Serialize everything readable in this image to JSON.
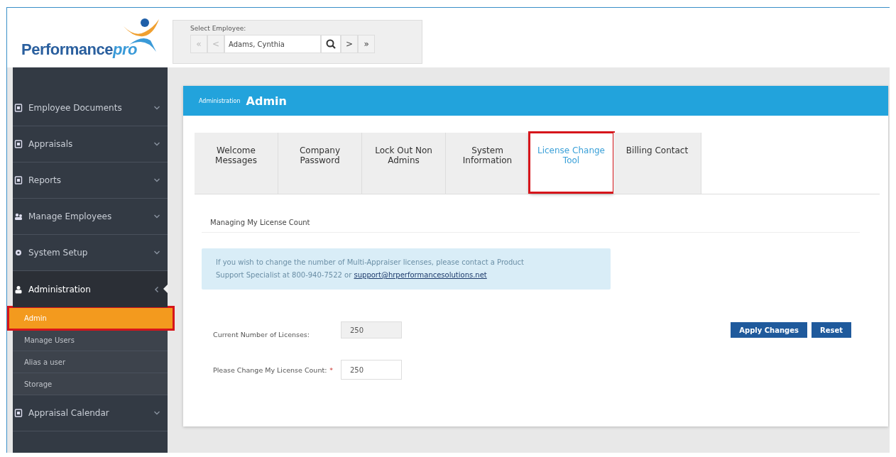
{
  "logo": {
    "name": "Performance",
    "suffix": "pro"
  },
  "employee_selector": {
    "label": "Select Employee:",
    "value": "Adams, Cynthia",
    "first": "«",
    "prev": "<",
    "next": ">",
    "last": "»"
  },
  "sidebar": {
    "items": [
      {
        "label": "Employee Documents",
        "expanded": false
      },
      {
        "label": "Appraisals",
        "expanded": false
      },
      {
        "label": "Reports",
        "expanded": false
      },
      {
        "label": "Manage Employees",
        "expanded": false
      },
      {
        "label": "System Setup",
        "expanded": false
      },
      {
        "label": "Administration",
        "expanded": true,
        "children": [
          {
            "label": "Admin",
            "selected": true,
            "highlighted": true
          },
          {
            "label": "Manage Users",
            "selected": false,
            "highlighted": false
          },
          {
            "label": "Alias a user",
            "selected": false,
            "highlighted": false
          },
          {
            "label": "Storage",
            "selected": false,
            "highlighted": false
          }
        ]
      },
      {
        "label": "Appraisal Calendar",
        "expanded": false
      }
    ]
  },
  "panel": {
    "breadcrumb": "Administration",
    "title": "Admin",
    "tabs": [
      {
        "label": "Welcome Messages",
        "selected": false,
        "highlighted": false
      },
      {
        "label": "Company Password",
        "selected": false,
        "highlighted": false
      },
      {
        "label": "Lock Out Non Admins",
        "selected": false,
        "highlighted": false
      },
      {
        "label": "System Information",
        "selected": false,
        "highlighted": false
      },
      {
        "label": "License Change Tool",
        "selected": true,
        "highlighted": true
      },
      {
        "label": "Billing Contact",
        "selected": false,
        "highlighted": false
      }
    ],
    "section_title": "Managing My License Count",
    "info": {
      "text": "If you wish to change the number of Multi-Appraiser licenses, please contact a Product Support Specialist at 800-940-7522 or",
      "link": "support@hrperformancesolutions.net"
    },
    "fields": [
      {
        "label": "Current Number of Licenses:",
        "value": "250",
        "disabled": true
      },
      {
        "label": "Please Change My License Count:",
        "value": "250",
        "required_mark": "*",
        "disabled": false
      }
    ],
    "buttons": [
      "Apply Changes",
      "Reset"
    ]
  }
}
